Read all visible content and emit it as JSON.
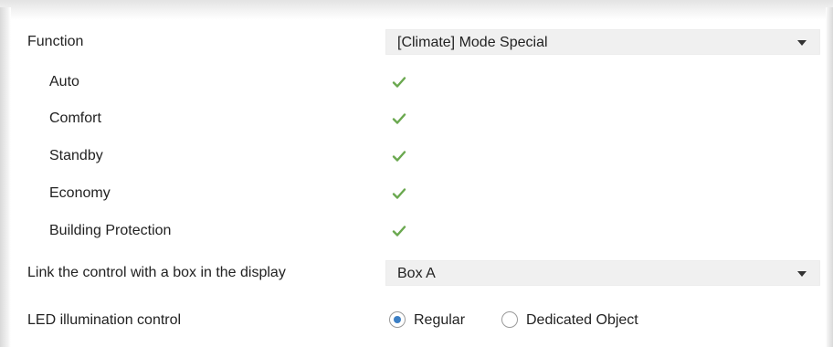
{
  "colors": {
    "check": "#6aa84f",
    "radio_selected": "#3c7fc4",
    "select_bg": "#f0f0f0"
  },
  "function": {
    "label": "Function",
    "value": "[Climate] Mode Special"
  },
  "modes": [
    {
      "label": "Auto",
      "checked": true
    },
    {
      "label": "Comfort",
      "checked": true
    },
    {
      "label": "Standby",
      "checked": true
    },
    {
      "label": "Economy",
      "checked": true
    },
    {
      "label": "Building Protection",
      "checked": true
    }
  ],
  "link_box": {
    "label": "Link the control with a box in the display",
    "value": "Box A"
  },
  "led": {
    "label": "LED illumination control",
    "options": [
      {
        "label": "Regular",
        "selected": true
      },
      {
        "label": "Dedicated Object",
        "selected": false
      }
    ]
  }
}
